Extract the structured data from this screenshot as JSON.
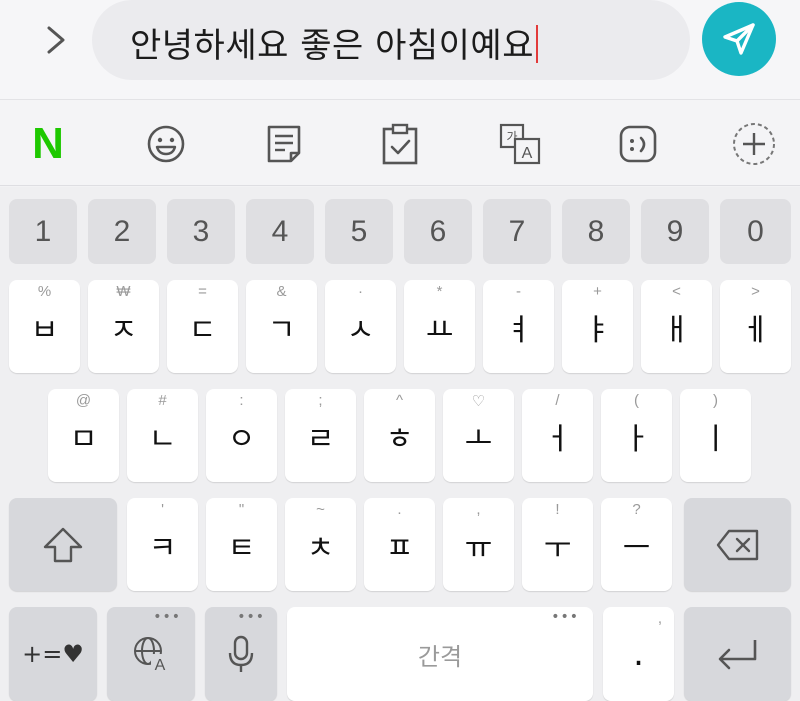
{
  "input": {
    "text": "안녕하세요 좋은 아침이예요"
  },
  "colors": {
    "send_button": "#1ab6c4",
    "naver_green": "#1ec800",
    "caret": "#e23a3a"
  },
  "toolbar": {
    "items": [
      "naver-n",
      "emoji-icon",
      "memo-icon",
      "clipboard-icon",
      "translate-icon",
      "emoticon-icon",
      "add-icon"
    ],
    "naver_label": "N"
  },
  "keyboard": {
    "numbers": [
      "1",
      "2",
      "3",
      "4",
      "5",
      "6",
      "7",
      "8",
      "9",
      "0"
    ],
    "row1": [
      {
        "main": "ㅂ",
        "hint": "%"
      },
      {
        "main": "ㅈ",
        "hint": "₩"
      },
      {
        "main": "ㄷ",
        "hint": "="
      },
      {
        "main": "ㄱ",
        "hint": "&"
      },
      {
        "main": "ㅅ",
        "hint": "·"
      },
      {
        "main": "ㅛ",
        "hint": "*"
      },
      {
        "main": "ㅕ",
        "hint": "-"
      },
      {
        "main": "ㅑ",
        "hint": "+"
      },
      {
        "main": "ㅐ",
        "hint": "<"
      },
      {
        "main": "ㅔ",
        "hint": ">"
      }
    ],
    "row2": [
      {
        "main": "ㅁ",
        "hint": "@"
      },
      {
        "main": "ㄴ",
        "hint": "#"
      },
      {
        "main": "ㅇ",
        "hint": ":"
      },
      {
        "main": "ㄹ",
        "hint": ";"
      },
      {
        "main": "ㅎ",
        "hint": "^"
      },
      {
        "main": "ㅗ",
        "hint": "♡"
      },
      {
        "main": "ㅓ",
        "hint": "/"
      },
      {
        "main": "ㅏ",
        "hint": "("
      },
      {
        "main": "ㅣ",
        "hint": ")"
      }
    ],
    "row3": [
      {
        "main": "ㅋ",
        "hint": "'"
      },
      {
        "main": "ㅌ",
        "hint": "\""
      },
      {
        "main": "ㅊ",
        "hint": "~"
      },
      {
        "main": "ㅍ",
        "hint": "."
      },
      {
        "main": "ㅠ",
        "hint": ","
      },
      {
        "main": "ㅜ",
        "hint": "!"
      },
      {
        "main": "ㅡ",
        "hint": "?"
      }
    ],
    "bottom": {
      "symbols_label": "+=♥",
      "space_label": "간격",
      "period_label": ".",
      "period_hint": ",",
      "more_dots": "•••"
    }
  }
}
